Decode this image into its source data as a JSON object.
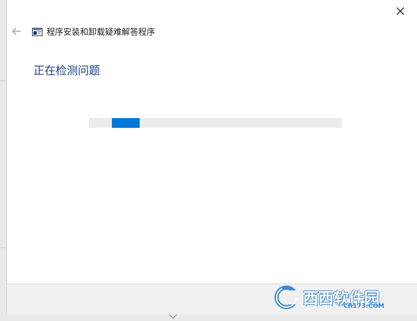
{
  "window": {
    "title": "程序安装和卸载疑难解答程序"
  },
  "header": {
    "close_icon": "close-icon",
    "back_icon": "back-arrow-icon"
  },
  "main": {
    "heading": "正在检测问题",
    "progress": {
      "mode": "indeterminate",
      "segment_start_fraction": 0.09,
      "segment_width_fraction": 0.11,
      "track_color": "#ececec",
      "fill_color": "#0078d7"
    }
  },
  "colors": {
    "heading_color": "#1e3e8a",
    "accent": "#0078d7"
  },
  "watermark": {
    "text": "西西软件园",
    "subtext": "CR173.COM"
  }
}
